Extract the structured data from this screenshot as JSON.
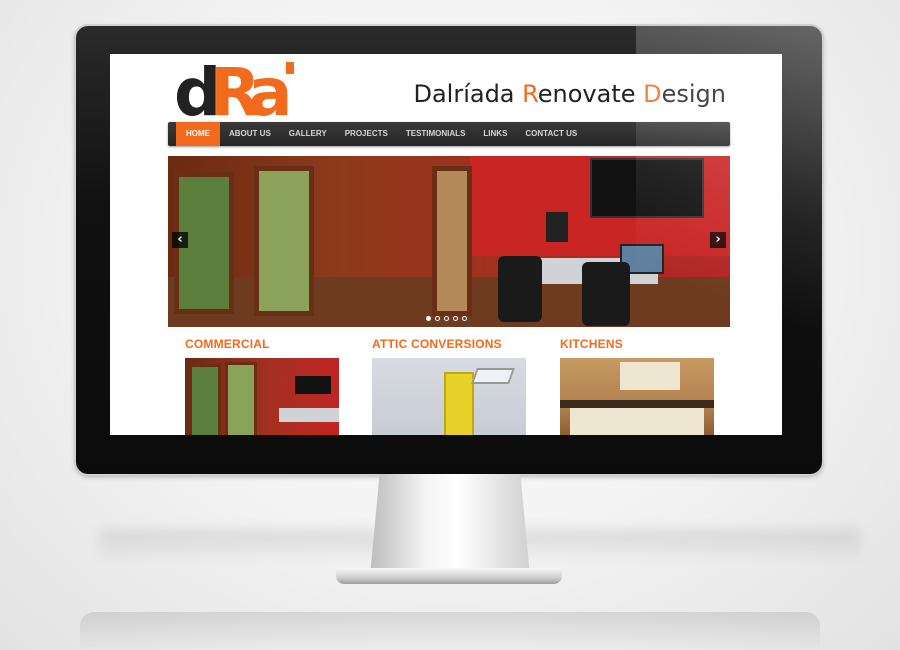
{
  "site": {
    "logo_letters": [
      "d",
      "R",
      "a"
    ],
    "brand": {
      "part1": "Dalríada ",
      "r": "R",
      "part2": "enovate ",
      "d": "D",
      "part3": "esign"
    }
  },
  "nav": {
    "items": [
      "HOME",
      "ABOUT US",
      "GALLERY",
      "PROJECTS",
      "TESTIMONIALS",
      "LINKS",
      "CONTACT US"
    ],
    "active_index": 0
  },
  "slider": {
    "prev_glyph": "‹",
    "next_glyph": "›",
    "slide_count": 5,
    "current_slide": 1
  },
  "categories": [
    {
      "title": "COMMERCIAL"
    },
    {
      "title": "ATTIC CONVERSIONS"
    },
    {
      "title": "KITCHENS"
    }
  ],
  "colors": {
    "accent": "#f26a1b",
    "nav_bg": "#2b2b2b",
    "logo_dark": "#222222"
  }
}
